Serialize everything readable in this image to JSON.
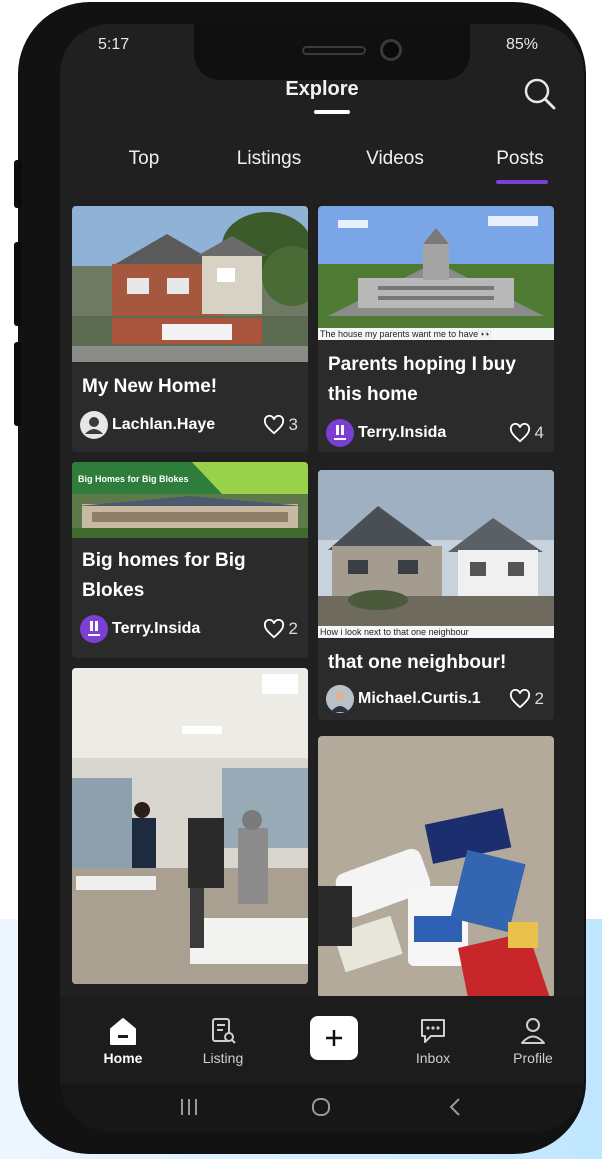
{
  "status": {
    "time": "5:17",
    "right": "85%"
  },
  "header": {
    "title": "Explore"
  },
  "tabs": [
    {
      "label": "Top"
    },
    {
      "label": "Listings"
    },
    {
      "label": "Videos"
    },
    {
      "label": "Posts",
      "active": true
    }
  ],
  "posts": [
    {
      "title": "My New Home!",
      "author": "Lachlan.Haye",
      "likes": "3"
    },
    {
      "title": "Parents hoping I buy this home",
      "caption": "The house my parents want me to have 👀",
      "author": "Terry.Insida",
      "likes": "4"
    },
    {
      "title": "Big homes for Big Blokes",
      "banner": "Big Homes for Big  Blokes",
      "author": "Terry.Insida",
      "likes": "2"
    },
    {
      "title": "that one neighbour!",
      "caption": "How i look next to that one neighbour",
      "author": "Michael.Curtis.1",
      "likes": "2"
    },
    {
      "title": "",
      "author": "",
      "likes": ""
    },
    {
      "title": "",
      "author": "",
      "likes": ""
    }
  ],
  "nav": {
    "home": "Home",
    "listing": "Listing",
    "inbox": "Inbox",
    "profile": "Profile"
  },
  "colors": {
    "accent": "#7b3fd4",
    "background": "#202020",
    "card": "#2b2b2b"
  }
}
